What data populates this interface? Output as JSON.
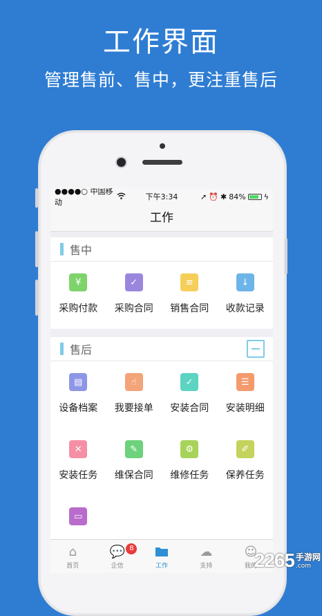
{
  "hero": {
    "title": "工作界面",
    "subtitle": "管理售前、售中，更注重售后"
  },
  "status": {
    "carrier": "●●●●○ 中国移动",
    "time": "下午3:34",
    "battery": "84%",
    "battery_level": 0.84
  },
  "nav": {
    "title": "工作"
  },
  "sections": [
    {
      "title": "售中",
      "items": [
        {
          "label": "采购付款",
          "color": "#7ed36b",
          "icon": "cart-money-icon"
        },
        {
          "label": "采购合同",
          "color": "#9b86de",
          "icon": "cart-contract-icon"
        },
        {
          "label": "销售合同",
          "color": "#f6cf5a",
          "icon": "document-icon"
        },
        {
          "label": "收款记录",
          "color": "#6db4e8",
          "icon": "download-icon"
        }
      ]
    },
    {
      "title": "售后",
      "items": [
        {
          "label": "设备档案",
          "color": "#8e96e6",
          "icon": "archive-icon"
        },
        {
          "label": "我要接单",
          "color": "#f3a479",
          "icon": "hand-icon"
        },
        {
          "label": "安装合同",
          "color": "#5dd3c2",
          "icon": "clipboard-check-icon"
        },
        {
          "label": "安装明细",
          "color": "#f59a6d",
          "icon": "list-icon"
        },
        {
          "label": "安装任务",
          "color": "#f58fa6",
          "icon": "tools-icon"
        },
        {
          "label": "维保合同",
          "color": "#6dd27b",
          "icon": "edit-icon"
        },
        {
          "label": "维修任务",
          "color": "#a8d35b",
          "icon": "wrench-gear-icon"
        },
        {
          "label": "保养任务",
          "color": "#c4d35b",
          "icon": "pen-icon"
        },
        {
          "label": "",
          "color": "#b96ccb",
          "icon": "inbox-icon"
        }
      ]
    }
  ],
  "tabs": [
    {
      "label": "首页",
      "icon": "home-icon"
    },
    {
      "label": "企信",
      "icon": "chat-icon",
      "badge": "8"
    },
    {
      "label": "工作",
      "icon": "folder-icon"
    },
    {
      "label": "支持",
      "icon": "cloud-icon"
    },
    {
      "label": "我的",
      "icon": "user-icon"
    }
  ],
  "watermark": {
    "number": "2265",
    "cn": "手游网",
    "domain": ".com"
  }
}
